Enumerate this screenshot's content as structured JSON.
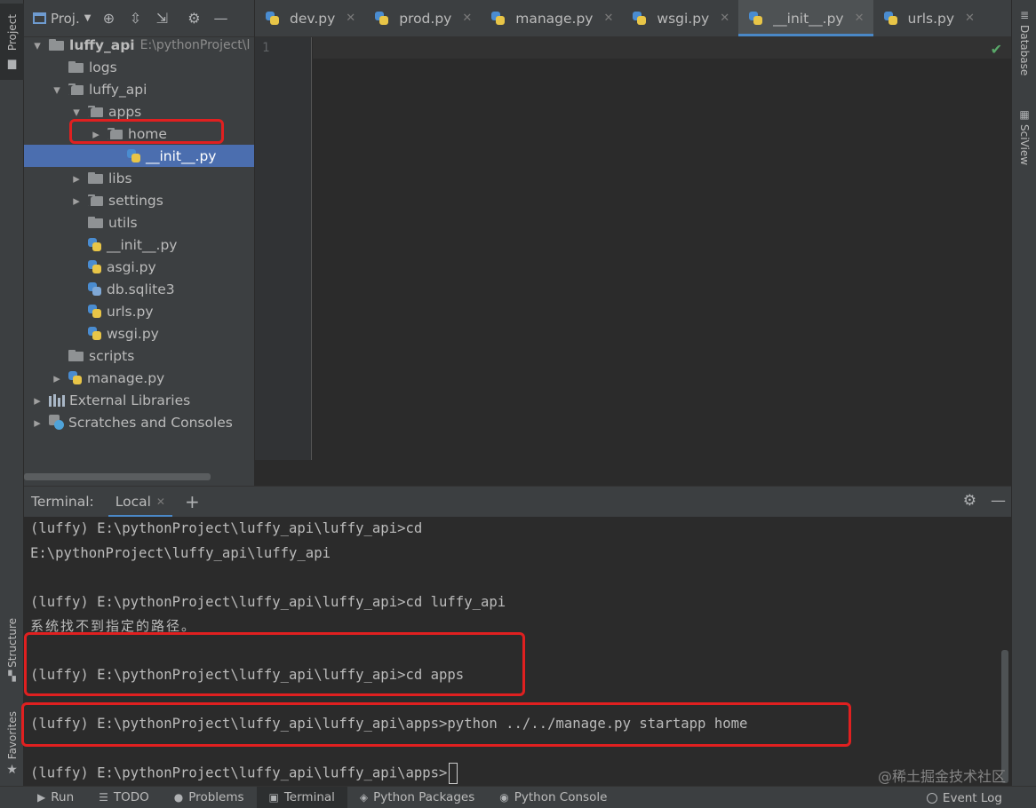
{
  "left_strip": {
    "project_tab": "Project",
    "structure_tab": "Structure",
    "favorites_tab": "Favorites"
  },
  "project_panel": {
    "title": "Proj.",
    "tree": [
      {
        "label": "luffy_api",
        "hint": "E:\\pythonProject\\l",
        "depth": 0,
        "arrow": "down",
        "icon": "folder",
        "bold": true
      },
      {
        "label": "logs",
        "depth": 1,
        "arrow": "none",
        "icon": "folder"
      },
      {
        "label": "luffy_api",
        "depth": 1,
        "arrow": "down",
        "icon": "package"
      },
      {
        "label": "apps",
        "depth": 2,
        "arrow": "down",
        "icon": "package"
      },
      {
        "label": "home",
        "depth": 3,
        "arrow": "right",
        "icon": "package"
      },
      {
        "label": "__init__.py",
        "depth": 4,
        "arrow": "none",
        "icon": "python",
        "selected": true
      },
      {
        "label": "libs",
        "depth": 2,
        "arrow": "right",
        "icon": "folder"
      },
      {
        "label": "settings",
        "depth": 2,
        "arrow": "right",
        "icon": "package"
      },
      {
        "label": "utils",
        "depth": 2,
        "arrow": "none",
        "icon": "folder"
      },
      {
        "label": "__init__.py",
        "depth": 2,
        "arrow": "none",
        "icon": "python"
      },
      {
        "label": "asgi.py",
        "depth": 2,
        "arrow": "none",
        "icon": "python"
      },
      {
        "label": "db.sqlite3",
        "depth": 2,
        "arrow": "none",
        "icon": "database"
      },
      {
        "label": "urls.py",
        "depth": 2,
        "arrow": "none",
        "icon": "python"
      },
      {
        "label": "wsgi.py",
        "depth": 2,
        "arrow": "none",
        "icon": "python"
      },
      {
        "label": "scripts",
        "depth": 1,
        "arrow": "none",
        "icon": "folder"
      },
      {
        "label": "manage.py",
        "depth": 1,
        "arrow": "right",
        "icon": "python"
      },
      {
        "label": "External Libraries",
        "depth": 0,
        "arrow": "right",
        "icon": "library"
      },
      {
        "label": "Scratches and Consoles",
        "depth": 0,
        "arrow": "right",
        "icon": "scratch"
      }
    ]
  },
  "editor": {
    "tabs": [
      {
        "label": "dev.py",
        "active": false
      },
      {
        "label": "prod.py",
        "active": false
      },
      {
        "label": "manage.py",
        "active": false
      },
      {
        "label": "wsgi.py",
        "active": false
      },
      {
        "label": "__init__.py",
        "active": true
      },
      {
        "label": "urls.py",
        "active": false
      }
    ],
    "line_number": "1"
  },
  "right_strip": {
    "database_tab": "Database",
    "sciview_tab": "SciView"
  },
  "terminal": {
    "title": "Terminal:",
    "tab_label": "Local",
    "lines": [
      "(luffy) E:\\pythonProject\\luffy_api\\luffy_api>cd",
      "E:\\pythonProject\\luffy_api\\luffy_api",
      "",
      "(luffy) E:\\pythonProject\\luffy_api\\luffy_api>cd luffy_api",
      "系统找不到指定的路径。",
      "",
      "(luffy) E:\\pythonProject\\luffy_api\\luffy_api>cd apps",
      "",
      "(luffy) E:\\pythonProject\\luffy_api\\luffy_api\\apps>python ../../manage.py startapp home",
      "",
      "(luffy) E:\\pythonProject\\luffy_api\\luffy_api\\apps>"
    ],
    "watermark": "@稀土掘金技术社区"
  },
  "bottom_bar": {
    "tabs": [
      {
        "label": "Run",
        "icon": "run-icon"
      },
      {
        "label": "TODO",
        "icon": "todo-icon"
      },
      {
        "label": "Problems",
        "icon": "problems-icon"
      },
      {
        "label": "Terminal",
        "icon": "terminal-icon",
        "active": true
      },
      {
        "label": "Python Packages",
        "icon": "packages-icon"
      },
      {
        "label": "Python Console",
        "icon": "python-console-icon"
      }
    ],
    "event_log": "Event Log"
  },
  "colors": {
    "accent": "#4a88c7",
    "selection": "#4b6eaf",
    "highlight_box": "#e02020",
    "check": "#59a869"
  }
}
